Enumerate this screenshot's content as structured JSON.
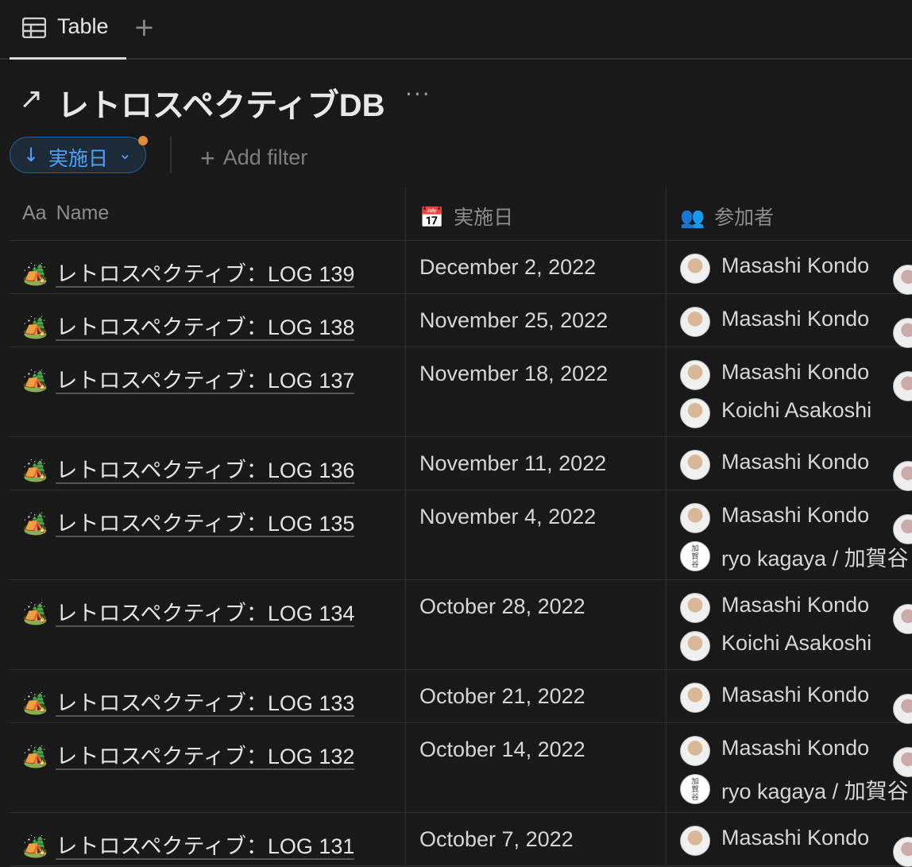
{
  "tabs": {
    "active_label": "Table",
    "add_label": "+"
  },
  "page": {
    "title": "レトロスペクティブDB",
    "more": "···"
  },
  "filters": {
    "sort_label": "実施日",
    "add_filter_label": "Add filter"
  },
  "columns": {
    "name": "Name",
    "name_prefix": "Aa",
    "date": "実施日",
    "people": "参加者"
  },
  "rows": [
    {
      "icon": "🏕️",
      "name": "レトロスペクティブ：LOG 139",
      "date": "December 2, 2022",
      "people": [
        "Masashi Kondo"
      ]
    },
    {
      "icon": "🏕️",
      "name": "レトロスペクティブ：LOG 138",
      "date": "November 25, 2022",
      "people": [
        "Masashi Kondo"
      ]
    },
    {
      "icon": "🏕️",
      "name": "レトロスペクティブ：LOG 137",
      "date": "November 18, 2022",
      "people": [
        "Masashi Kondo",
        "Koichi Asakoshi"
      ]
    },
    {
      "icon": "🏕️",
      "name": "レトロスペクティブ：LOG 136",
      "date": "November 11, 2022",
      "people": [
        "Masashi Kondo"
      ]
    },
    {
      "icon": "🏕️",
      "name": "レトロスペクティブ：LOG 135",
      "date": "November 4, 2022",
      "people": [
        "Masashi Kondo",
        "ryo kagaya / 加賀谷"
      ]
    },
    {
      "icon": "🏕️",
      "name": "レトロスペクティブ：LOG 134",
      "date": "October 28, 2022",
      "people": [
        "Masashi Kondo",
        "Koichi Asakoshi"
      ]
    },
    {
      "icon": "🏕️",
      "name": "レトロスペクティブ：LOG 133",
      "date": "October 21, 2022",
      "people": [
        "Masashi Kondo"
      ]
    },
    {
      "icon": "🏕️",
      "name": "レトロスペクティブ：LOG 132",
      "date": "October 14, 2022",
      "people": [
        "Masashi Kondo",
        "ryo kagaya / 加賀谷"
      ]
    },
    {
      "icon": "🏕️",
      "name": "レトロスペクティブ：LOG 131",
      "date": "October 7, 2022",
      "people": [
        "Masashi Kondo"
      ]
    }
  ]
}
